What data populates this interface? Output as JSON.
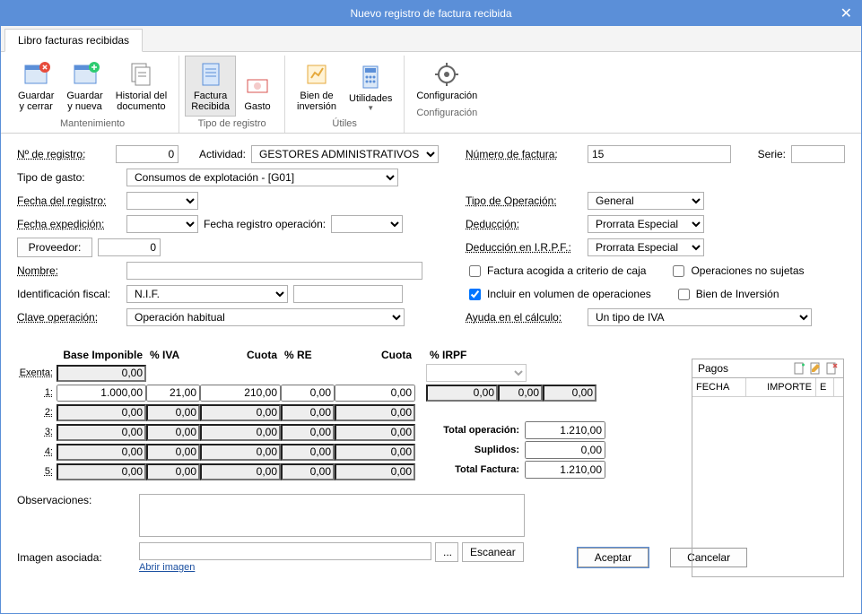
{
  "window": {
    "title": "Nuevo registro de factura recibida"
  },
  "tab": {
    "label": "Libro facturas recibidas"
  },
  "ribbon": {
    "guardar_cerrar": "Guardar\ny cerrar",
    "guardar_nueva": "Guardar\ny nueva",
    "historial": "Historial del\ndocumento",
    "factura_recibida": "Factura\nRecibida",
    "gasto": "Gasto",
    "bien_inversion": "Bien de\ninversión",
    "utilidades": "Utilidades",
    "configuracion": "Configuración",
    "grp_mantenimiento": "Mantenimiento",
    "grp_tipo_registro": "Tipo de registro",
    "grp_utiles": "Útiles",
    "grp_configuracion": "Configuración"
  },
  "labels": {
    "n_registro": "Nº de registro:",
    "actividad": "Actividad:",
    "numero_factura": "Número de factura:",
    "serie": "Serie:",
    "tipo_gasto": "Tipo de gasto:",
    "fecha_registro": "Fecha del registro:",
    "fecha_expedicion": "Fecha expedición:",
    "fecha_reg_op": "Fecha registro operación:",
    "tipo_operacion": "Tipo de Operación:",
    "deduccion": "Deducción:",
    "deduccion_irpf": "Deducción en I.R.P.F.:",
    "proveedor": "Proveedor:",
    "nombre": "Nombre:",
    "identificacion_fiscal": "Identificación fiscal:",
    "clave_operacion": "Clave operación:",
    "ayuda_calculo": "Ayuda en el cálculo:",
    "observaciones": "Observaciones:",
    "imagen_asociada": "Imagen asociada:",
    "abrir_imagen": "Abrir imagen",
    "escanear": "Escanear",
    "browse": "...",
    "aceptar": "Aceptar",
    "cancelar": "Cancelar"
  },
  "checks": {
    "factura_caja": "Factura acogida a criterio de caja",
    "op_no_sujetas": "Operaciones no sujetas",
    "incluir_vol": "Incluir en  volumen de operaciones",
    "bien_inversion": "Bien de Inversión"
  },
  "values": {
    "n_registro": "0",
    "actividad": "GESTORES ADMINISTRATIVOS",
    "numero_factura": "15",
    "serie": "",
    "tipo_gasto": "Consumos de explotación - [G01]",
    "fecha_registro": "",
    "fecha_expedicion": "",
    "fecha_reg_op": "",
    "tipo_operacion": "General",
    "deduccion": "Prorrata Especial",
    "deduccion_irpf": "Prorrata Especial",
    "proveedor": "0",
    "nombre": "",
    "identificacion_fiscal": "N.I.F.",
    "nif_num": "",
    "clave_operacion": "Operación habitual",
    "ayuda_calculo": "Un tipo de IVA",
    "factura_caja": false,
    "op_no_sujetas": false,
    "incluir_vol": true,
    "bien_inversion": false,
    "observaciones": "",
    "imagen_asociada": ""
  },
  "tax": {
    "hdr_base": "Base Imponible",
    "hdr_piva": "% IVA",
    "hdr_cuota": "Cuota",
    "hdr_pre": "% RE",
    "hdr_cuotare": "Cuota",
    "hdr_pirpf": "% IRPF",
    "lbl_exenta": "Exenta:",
    "lbl_1": "1:",
    "lbl_2": "2:",
    "lbl_3": "3:",
    "lbl_4": "4:",
    "lbl_5": "5:",
    "exenta_base": "0,00",
    "irpf_pct": "",
    "irpf_base": "0,00",
    "irpf_pctv": "0,00",
    "irpf_cuota": "0,00",
    "r1": {
      "base": "1.000,00",
      "piva": "21,00",
      "cuota": "210,00",
      "pre": "0,00",
      "cre": "0,00"
    },
    "r2": {
      "base": "0,00",
      "piva": "0,00",
      "cuota": "0,00",
      "pre": "0,00",
      "cre": "0,00"
    },
    "r3": {
      "base": "0,00",
      "piva": "0,00",
      "cuota": "0,00",
      "pre": "0,00",
      "cre": "0,00"
    },
    "r4": {
      "base": "0,00",
      "piva": "0,00",
      "cuota": "0,00",
      "pre": "0,00",
      "cre": "0,00"
    },
    "r5": {
      "base": "0,00",
      "piva": "0,00",
      "cuota": "0,00",
      "pre": "0,00",
      "cre": "0,00"
    },
    "lbl_total_op": "Total operación:",
    "total_op": "1.210,00",
    "lbl_suplidos": "Suplidos:",
    "suplidos": "0,00",
    "lbl_total_fact": "Total Factura:",
    "total_fact": "1.210,00"
  },
  "pagos": {
    "title": "Pagos",
    "col_fecha": "FECHA",
    "col_importe": "IMPORTE",
    "col_e": "E"
  }
}
